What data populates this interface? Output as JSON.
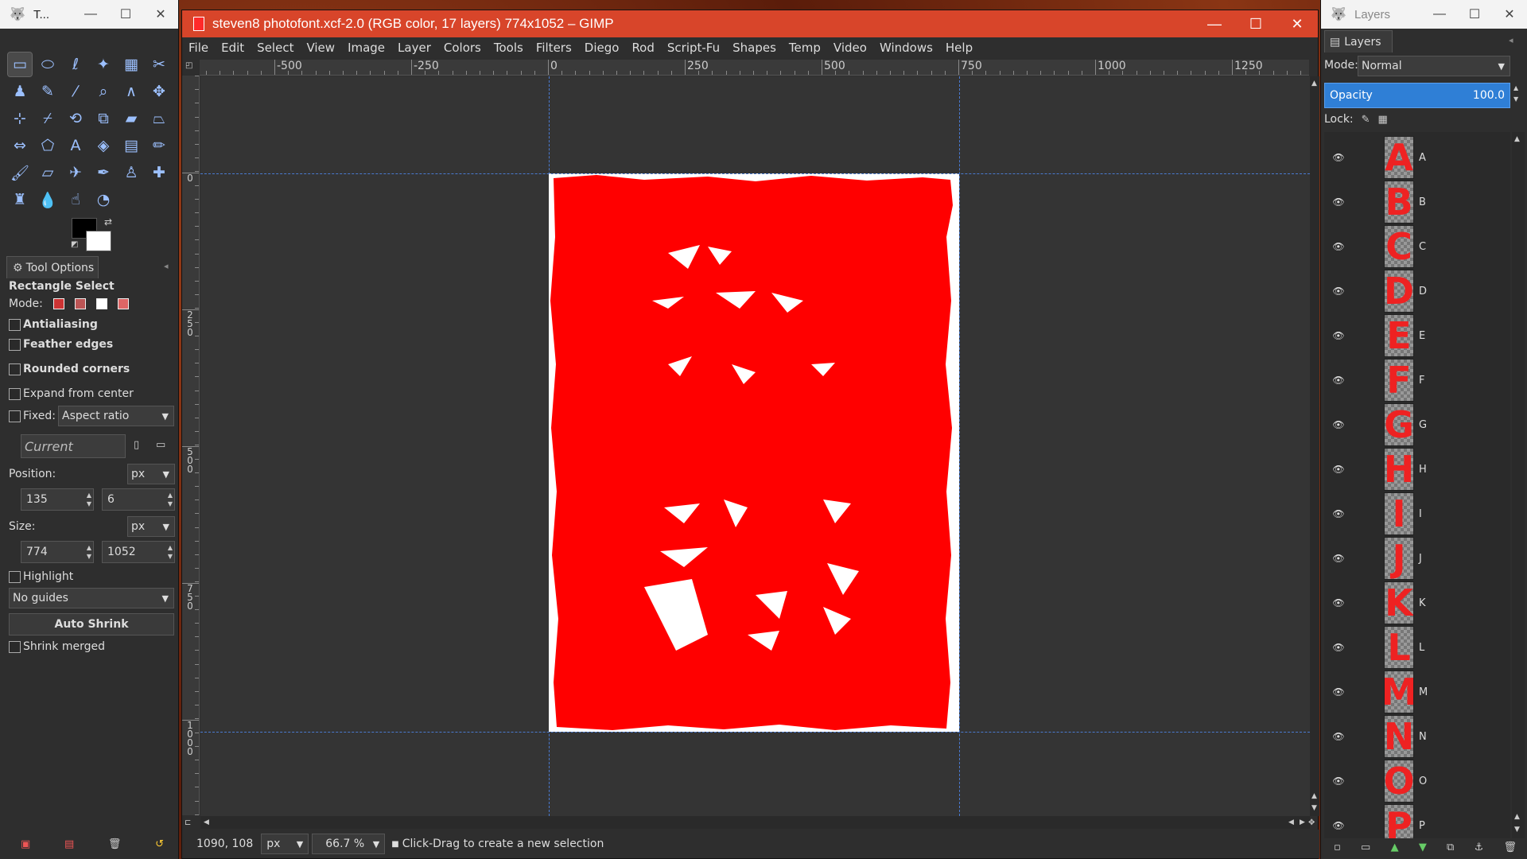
{
  "toolbox": {
    "title": "T...",
    "tools": [
      {
        "icon": "rect-select-icon",
        "glyph": "▭",
        "active": true
      },
      {
        "icon": "ellipse-select-icon",
        "glyph": "⬭"
      },
      {
        "icon": "free-select-icon",
        "glyph": "ℓ"
      },
      {
        "icon": "fuzzy-select-icon",
        "glyph": "✦"
      },
      {
        "icon": "select-by-color-icon",
        "glyph": "▦"
      },
      {
        "icon": "scissors-select-icon",
        "glyph": "✂"
      },
      {
        "icon": "foreground-select-icon",
        "glyph": "♟"
      },
      {
        "icon": "paths-icon",
        "glyph": "✎"
      },
      {
        "icon": "color-picker-icon",
        "glyph": "⁄"
      },
      {
        "icon": "zoom-icon",
        "glyph": "⌕"
      },
      {
        "icon": "measure-icon",
        "glyph": "∧"
      },
      {
        "icon": "move-icon",
        "glyph": "✥"
      },
      {
        "icon": "alignment-icon",
        "glyph": "⊹"
      },
      {
        "icon": "crop-icon",
        "glyph": "⌿"
      },
      {
        "icon": "rotate-icon",
        "glyph": "⟲"
      },
      {
        "icon": "scale-icon",
        "glyph": "⧉"
      },
      {
        "icon": "shear-icon",
        "glyph": "▰"
      },
      {
        "icon": "perspective-icon",
        "glyph": "⏢"
      },
      {
        "icon": "flip-icon",
        "glyph": "⇔"
      },
      {
        "icon": "cage-transform-icon",
        "glyph": "⬠"
      },
      {
        "icon": "text-icon",
        "glyph": "A"
      },
      {
        "icon": "bucket-fill-icon",
        "glyph": "◈"
      },
      {
        "icon": "blend-icon",
        "glyph": "▤"
      },
      {
        "icon": "pencil-icon",
        "glyph": "✏"
      },
      {
        "icon": "paintbrush-icon",
        "glyph": "🖌"
      },
      {
        "icon": "eraser-icon",
        "glyph": "▱"
      },
      {
        "icon": "airbrush-icon",
        "glyph": "✈"
      },
      {
        "icon": "ink-icon",
        "glyph": "✒"
      },
      {
        "icon": "clone-icon",
        "glyph": "♙"
      },
      {
        "icon": "heal-icon",
        "glyph": "✚"
      },
      {
        "icon": "perspective-clone-icon",
        "glyph": "♜"
      },
      {
        "icon": "blur-icon",
        "glyph": "💧"
      },
      {
        "icon": "smudge-icon",
        "glyph": "☝"
      },
      {
        "icon": "dodge-burn-icon",
        "glyph": "◔"
      }
    ],
    "tool_options_tab": "Tool Options",
    "options": {
      "title": "Rectangle Select",
      "mode_label": "Mode:",
      "antialiasing": "Antialiasing",
      "feather_edges": "Feather edges",
      "rounded_corners": "Rounded corners",
      "expand_from_center": "Expand from center",
      "fixed_label": "Fixed:",
      "fixed_value": "Aspect ratio",
      "current_placeholder": "Current",
      "position_label": "Position:",
      "position_unit": "px",
      "position_x": "135",
      "position_y": "6",
      "size_label": "Size:",
      "size_unit": "px",
      "size_w": "774",
      "size_h": "1052",
      "highlight": "Highlight",
      "guides_value": "No guides",
      "auto_shrink": "Auto Shrink",
      "shrink_merged": "Shrink merged"
    }
  },
  "image_window": {
    "title": "steven8 photofont.xcf-2.0 (RGB color, 17 layers) 774x1052 – GIMP",
    "menu": [
      "File",
      "Edit",
      "Select",
      "View",
      "Image",
      "Layer",
      "Colors",
      "Tools",
      "Filters",
      "Diego",
      "Rod",
      "Script-Fu",
      "Shapes",
      "Temp",
      "Video",
      "Windows",
      "Help"
    ],
    "ruler_top": [
      "-500",
      "-250",
      "0",
      "250",
      "500",
      "750",
      "1000",
      "1250"
    ],
    "ruler_left": [
      "0",
      "250",
      "500",
      "750",
      "1000"
    ],
    "status": {
      "coords": "1090, 108",
      "unit": "px",
      "zoom": "66.7 %",
      "message": "Click-Drag to create a new selection"
    },
    "image_color": "#ff0000"
  },
  "layers": {
    "title": "Layers",
    "tab": "Layers",
    "mode_label": "Mode:",
    "mode_value": "Normal",
    "opacity_label": "Opacity",
    "opacity_value": "100.0",
    "lock_label": "Lock:",
    "items": [
      "A",
      "B",
      "C",
      "D",
      "E",
      "F",
      "G",
      "H",
      "I",
      "J",
      "K",
      "L",
      "M",
      "N",
      "O",
      "P"
    ]
  }
}
